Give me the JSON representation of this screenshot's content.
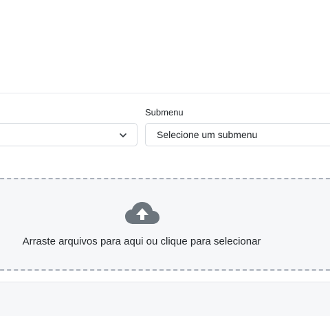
{
  "form": {
    "submenu_label": "Submenu",
    "submenu_value": "Selecione um submenu"
  },
  "upload": {
    "instructions": "Arraste arquivos para aqui ou clique para selecionar",
    "icon": "cloud-upload-icon"
  },
  "colors": {
    "icon": "#6c757d",
    "dropzone_bg": "#f6f7f9",
    "dropzone_border": "#a9b0ba"
  }
}
